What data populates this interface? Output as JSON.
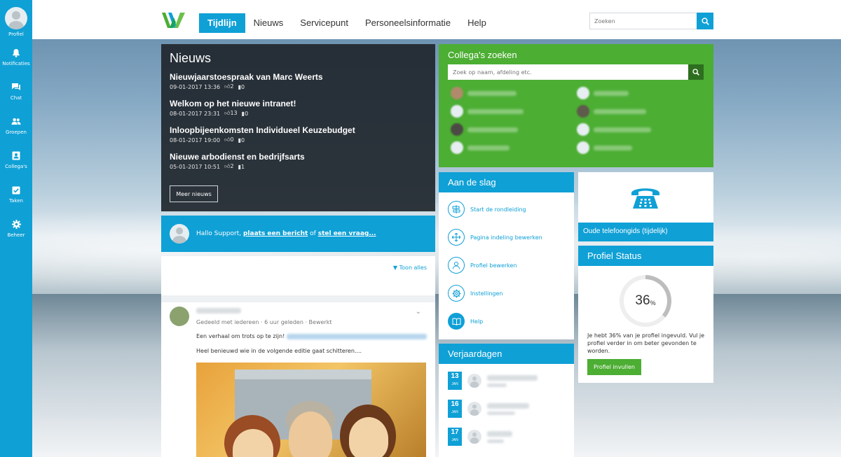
{
  "sidebar": {
    "items": [
      {
        "label": "Profiel",
        "icon": "user-avatar"
      },
      {
        "label": "Notificaties",
        "icon": "bell-icon"
      },
      {
        "label": "Chat",
        "icon": "chat-icon"
      },
      {
        "label": "Groepen",
        "icon": "group-icon"
      },
      {
        "label": "Collega's",
        "icon": "contact-card-icon"
      },
      {
        "label": "Taken",
        "icon": "checkbox-icon"
      },
      {
        "label": "Beheer",
        "icon": "gear-icon"
      }
    ]
  },
  "header": {
    "nav": [
      "Tijdlijn",
      "Nieuws",
      "Servicepunt",
      "Personeelsinformatie",
      "Help"
    ],
    "active": "Tijdlijn",
    "search_placeholder": "Zoeken"
  },
  "news": {
    "title": "Nieuws",
    "items": [
      {
        "title": "Nieuwjaarstoespraak van Marc Weerts",
        "date": "09-01-2017 13:36",
        "likes": "2",
        "comments": "0"
      },
      {
        "title": "Welkom op het nieuwe intranet!",
        "date": "08-01-2017 23:31",
        "likes": "13",
        "comments": "0"
      },
      {
        "title": "Inloopbijeenkomsten Individueel Keuzebudget",
        "date": "08-01-2017 19:00",
        "likes": "0",
        "comments": "0"
      },
      {
        "title": "Nieuwe arbodienst en bedrijfsarts",
        "date": "05-01-2017 10:51",
        "likes": "2",
        "comments": "1"
      }
    ],
    "more_label": "Meer nieuws"
  },
  "postbar": {
    "greeting": "Hallo Support, ",
    "link1": "plaats een bericht",
    "or": " of ",
    "link2": "stel een vraag..."
  },
  "timeline": {
    "filter_label": "Toon alles",
    "post": {
      "meta": "Gedeeld met iedereen · 6 uur geleden · Bewerkt",
      "line1": "Een verhaal om trots op te zijn!",
      "line2": "Heel benieuwd wie in de volgende editie gaat schitteren...."
    }
  },
  "colleagues": {
    "title": "Collega's zoeken",
    "search_placeholder": "Zoek op naam, afdeling etc."
  },
  "getting_started": {
    "title": "Aan de slag",
    "items": [
      {
        "label": "Start de rondleiding",
        "icon": "signpost-icon"
      },
      {
        "label": "Pagina indeling bewerken",
        "icon": "move-arrows-icon"
      },
      {
        "label": "Profiel bewerken",
        "icon": "user-outline-icon"
      },
      {
        "label": "Instellingen",
        "icon": "gear-outline-icon"
      },
      {
        "label": "Help",
        "icon": "book-icon"
      }
    ]
  },
  "phonebook": {
    "label": "Oude telefoongids (tijdelijk)",
    "icon": "telephone-icon"
  },
  "profile_status": {
    "title": "Profiel Status",
    "percent": 36,
    "percent_text": "36",
    "percent_sign": "%",
    "text": "Je hebt 36% van je profiel ingevuld. Vul je profiel verder in om beter gevonden te worden.",
    "button_label": "Profiel invullen"
  },
  "birthdays": {
    "title": "Verjaardagen",
    "items": [
      {
        "day": "13",
        "month": "JAN"
      },
      {
        "day": "16",
        "month": "JAN"
      },
      {
        "day": "17",
        "month": "JAN"
      }
    ]
  },
  "colors": {
    "brand_blue": "#0fa0d6",
    "brand_green": "#4cae33",
    "news_dark": "#20262c"
  }
}
